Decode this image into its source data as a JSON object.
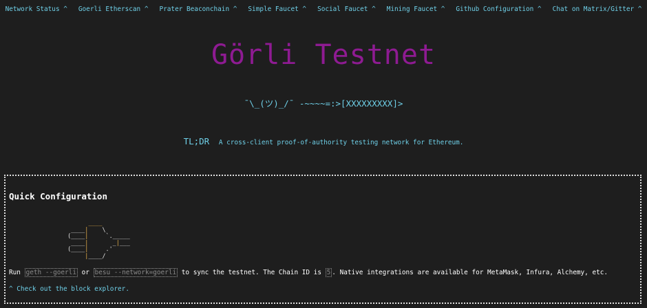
{
  "nav": {
    "links": [
      "Network Status ^",
      "Goerli Etherscan ^",
      "Prater Beaconchain ^",
      "Simple Faucet ^",
      "Social Faucet ^",
      "Mining Faucet ^",
      "Github Configuration ^",
      "Chat on Matrix/Gitter ^"
    ]
  },
  "hero": {
    "title": "Görli Testnet",
    "shrug": "¯\\_(ツ)_/¯ -~~~~=:>[XXXXXXXXX]>",
    "tldr_label": "TL;DR",
    "tldr_text": "A cross-client proof-of-authority testing network for Ethereum."
  },
  "quick_config": {
    "heading": "Quick Configuration",
    "run_prefix": "Run",
    "geth_cmd": "geth --goerli",
    "or_text": "or",
    "besu_cmd": "besu --network=goerli",
    "sync_text": "to sync the testnet. The Chain ID is",
    "chain_id": "5",
    "integrations_text": ". Native integrations are available for MetaMask, Infura, Alchemy, etc.",
    "explorer_link": "^ Check out the block explorer."
  },
  "colors": {
    "background": "#1e1e1e",
    "title": "#8e1b92",
    "link": "#6fd0e8",
    "separator": "#f0a0b8",
    "ascii_accent": "#e8b24a"
  }
}
